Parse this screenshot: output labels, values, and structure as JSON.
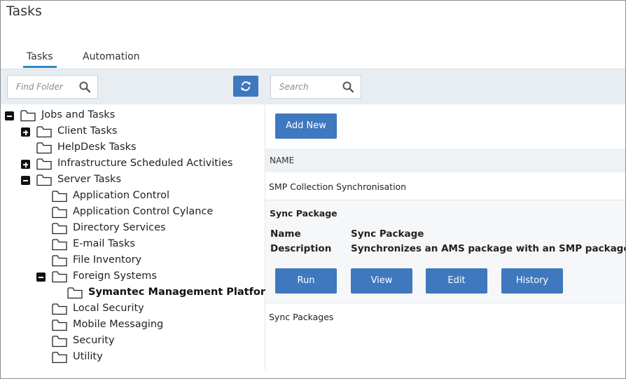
{
  "page": {
    "title": "Tasks"
  },
  "tabs": [
    {
      "label": "Tasks",
      "active": true
    },
    {
      "label": "Automation",
      "active": false
    }
  ],
  "folder_search": {
    "placeholder": "Find Folder"
  },
  "task_search": {
    "placeholder": "Search"
  },
  "tree": {
    "items": [
      {
        "label": "Jobs and Tasks",
        "toggle": "minus"
      },
      {
        "label": "Client Tasks",
        "toggle": "plus"
      },
      {
        "label": "HelpDesk Tasks",
        "toggle": "none"
      },
      {
        "label": "Infrastructure Scheduled Activities",
        "toggle": "plus"
      },
      {
        "label": "Server Tasks",
        "toggle": "minus"
      },
      {
        "label": "Application Control",
        "toggle": "none"
      },
      {
        "label": "Application Control Cylance",
        "toggle": "none"
      },
      {
        "label": "Directory Services",
        "toggle": "none"
      },
      {
        "label": "E-mail Tasks",
        "toggle": "none"
      },
      {
        "label": "File Inventory",
        "toggle": "none"
      },
      {
        "label": "Foreign Systems",
        "toggle": "minus"
      },
      {
        "label": "Symantec Management Platform",
        "toggle": "none",
        "selected": true
      },
      {
        "label": "Local Security",
        "toggle": "none"
      },
      {
        "label": "Mobile Messaging",
        "toggle": "none"
      },
      {
        "label": "Security",
        "toggle": "none"
      },
      {
        "label": "Utility",
        "toggle": "none"
      }
    ]
  },
  "main": {
    "add_new_label": "Add New",
    "column_header": "NAME",
    "rows": [
      {
        "name": "SMP Collection Synchronisation"
      },
      {
        "name": "Sync Packages"
      }
    ],
    "detail": {
      "title": "Sync Package",
      "name_key": "Name",
      "name_value": "Sync Package",
      "description_key": "Description",
      "description_value": "Synchronizes an AMS package with an SMP package.",
      "buttons": {
        "run": "Run",
        "view": "View",
        "edit": "Edit",
        "history": "History"
      }
    }
  },
  "colors": {
    "accent": "#3f78be",
    "tab_underline": "#2a88c9",
    "band": "#e8edf2"
  },
  "icons": {
    "search": "search-icon",
    "refresh": "refresh-icon",
    "folder": "folder-icon",
    "expand": "plus-box-icon",
    "collapse": "minus-box-icon"
  }
}
